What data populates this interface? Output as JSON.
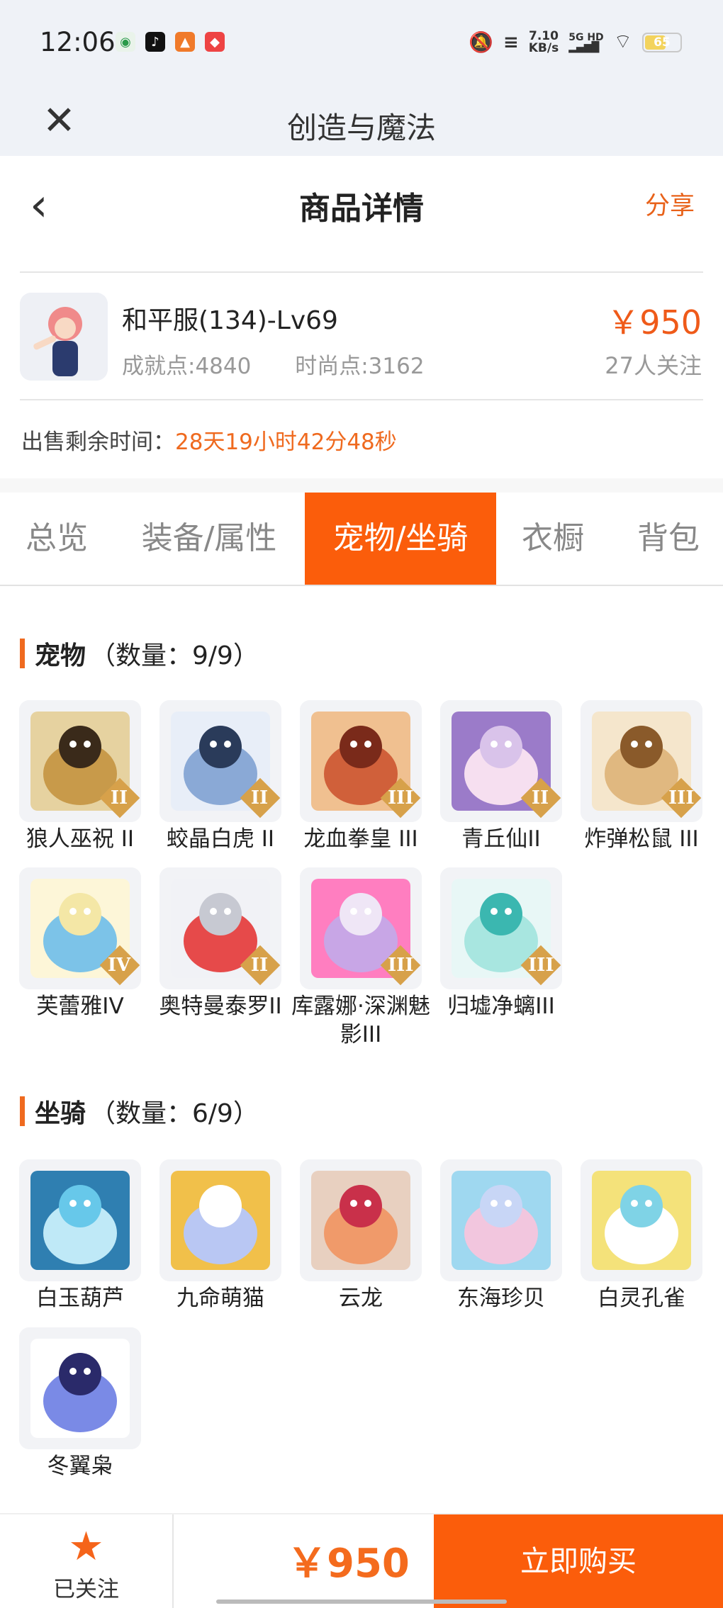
{
  "status_bar": {
    "time": "12:06",
    "speed_top": "7.10",
    "speed_bottom": "KB/s",
    "network": "5G HD",
    "battery": "65"
  },
  "app_bar": {
    "title": "创造与魔法"
  },
  "page_header": {
    "title": "商品详情",
    "share_label": "分享"
  },
  "product": {
    "name": "和平服(134)-Lv69",
    "achievement": "成就点:4840",
    "fashion": "时尚点:3162",
    "price": "￥950",
    "followers": "27人关注"
  },
  "remaining": {
    "label": "出售剩余时间：",
    "value": "28天19小时42分48秒"
  },
  "tabs": [
    {
      "label": "总览"
    },
    {
      "label": "装备/属性"
    },
    {
      "label": "宠物/坐骑"
    },
    {
      "label": "衣橱"
    },
    {
      "label": "背包"
    }
  ],
  "active_tab": "宠物/坐骑",
  "pets": {
    "title": "宠物",
    "count": "（数量：9/9）",
    "items": [
      {
        "label": "狼人巫祝 II",
        "badge": "II",
        "icon": "werewolf-pet-icon"
      },
      {
        "label": "蛟晶白虎 II",
        "badge": "II",
        "icon": "white-tiger-pet-icon"
      },
      {
        "label": "龙血拳皇 III",
        "badge": "III",
        "icon": "dragon-boxer-pet-icon"
      },
      {
        "label": "青丘仙II",
        "badge": "II",
        "icon": "fox-fairy-pet-icon"
      },
      {
        "label": "炸弹松鼠 III",
        "badge": "III",
        "icon": "bomb-squirrel-pet-icon"
      },
      {
        "label": "芙蕾雅IV",
        "badge": "IV",
        "icon": "freya-pet-icon"
      },
      {
        "label": "奥特曼泰罗II",
        "badge": "II",
        "icon": "ultraman-pet-icon"
      },
      {
        "label": "库露娜·深渊魅影III",
        "badge": "III",
        "icon": "kuluna-pet-icon"
      },
      {
        "label": "归墟净螭III",
        "badge": "III",
        "icon": "water-dragon-pet-icon"
      }
    ]
  },
  "mounts": {
    "title": "坐骑",
    "count": "（数量：6/9）",
    "items": [
      {
        "label": "白玉葫芦",
        "icon": "jade-gourd-mount-icon"
      },
      {
        "label": "九命萌猫",
        "icon": "nine-lives-cat-mount-icon"
      },
      {
        "label": "云龙",
        "icon": "cloud-dragon-mount-icon"
      },
      {
        "label": "东海珍贝",
        "icon": "pearl-shell-mount-icon"
      },
      {
        "label": "白灵孔雀",
        "icon": "white-peacock-mount-icon"
      },
      {
        "label": "冬翼枭",
        "icon": "winter-owl-mount-icon"
      }
    ]
  },
  "bottom_bar": {
    "follow_label": "已关注",
    "price": "￥950",
    "buy_label": "立即购买"
  },
  "colors": {
    "accent": "#fb5d0b",
    "price": "#ef5a19",
    "badge": "#d7a14a"
  }
}
